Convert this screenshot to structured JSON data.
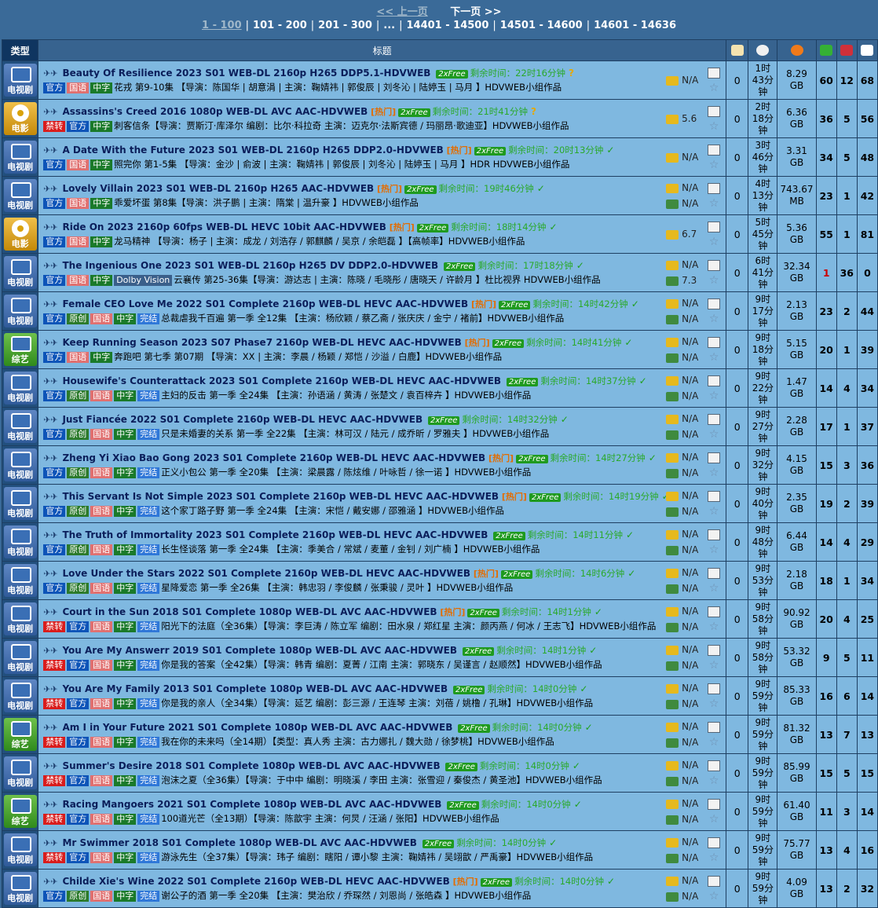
{
  "pager": {
    "prev": "<< 上一页",
    "next": "下一页 >>",
    "ranges": [
      "1 - 100",
      "101 - 200",
      "201 - 300",
      "...",
      "14401 - 14500",
      "14501 - 14600",
      "14601 - 14636"
    ]
  },
  "header": {
    "type": "类型",
    "title": "标题"
  },
  "rows": [
    {
      "cat": "电视剧",
      "kind": "tv",
      "title": "Beauty Of Resilience 2023 S01 WEB-DL 2160p H265 DDP5.1-HDVWEB",
      "hot": "",
      "free": "2xFree",
      "remain": "剩余时间：22时16分钟",
      "mark": "?",
      "tags": [
        "官方",
        "国语",
        "中字"
      ],
      "desc": "花戎 第9-10集 【导演：陈国华 | 胡意涓 | 主演：鞠婧祎 | 郭俊辰 | 刘冬沁 | 陆婷玉 | 马月 】HDVWEB小组作品",
      "r1": "N/A",
      "r2": "",
      "c": "0",
      "t": "1时\n43分钟",
      "s": "8.29\nGB",
      "se": "60",
      "le": "12",
      "sn": "68"
    },
    {
      "cat": "电影",
      "kind": "movie",
      "title": "Assassins's Creed 2016 1080p WEB-DL AVC AAC-HDVWEB",
      "hot": "[热门]",
      "free": "2xFree",
      "remain": "剩余时间：21时41分钟",
      "mark": "?",
      "tags": [
        "禁转",
        "官方",
        "中字"
      ],
      "desc": "刺客信条【导演：贾斯汀·库泽尔 编剧：比尔·科拉奇 主演：迈克尔·法斯宾德 / 玛丽昂·歌迪亚】HDVWEB小组作品",
      "r1": "5.6",
      "r2": "",
      "c": "0",
      "t": "2时\n18分钟",
      "s": "6.36\nGB",
      "se": "36",
      "le": "5",
      "sn": "56"
    },
    {
      "cat": "电视剧",
      "kind": "tv",
      "title": "A Date With the Future 2023 S01 WEB-DL 2160p H265 DDP2.0-HDVWEB",
      "hot": "[热门]",
      "free": "2xFree",
      "remain": "剩余时间：20时13分钟",
      "mark": "✓",
      "tags": [
        "官方",
        "国语",
        "中字"
      ],
      "desc": "照完你 第1-5集 【导演：金沙 | 俞波 | 主演：鞠婧祎 | 郭俊辰 | 刘冬沁 | 陆婷玉 | 马月 】HDR HDVWEB小组作品",
      "r1": "N/A",
      "r2": "",
      "c": "0",
      "t": "3时\n46分钟",
      "s": "3.31\nGB",
      "se": "34",
      "le": "5",
      "sn": "48"
    },
    {
      "cat": "电视剧",
      "kind": "tv",
      "title": "Lovely Villain 2023 S01 WEB-DL 2160p H265 AAC-HDVWEB",
      "hot": "[热门]",
      "free": "2xFree",
      "remain": "剩余时间：19时46分钟",
      "mark": "✓",
      "tags": [
        "官方",
        "国语",
        "中字"
      ],
      "desc": "乖爱坏蛋 第8集【导演：洪子鹏 | 主演：隋棠 | 温升豪 】HDVWEB小组作品",
      "r1": "N/A",
      "r2": "N/A",
      "c": "0",
      "t": "4时\n13分钟",
      "s": "743.67\nMB",
      "se": "23",
      "le": "1",
      "sn": "42"
    },
    {
      "cat": "电影",
      "kind": "movie",
      "title": "Ride On 2023 2160p 60fps WEB-DL HEVC 10bit AAC-HDVWEB",
      "hot": "[热门]",
      "free": "2xFree",
      "remain": "剩余时间：18时14分钟",
      "mark": "✓",
      "tags": [
        "官方",
        "国语",
        "中字"
      ],
      "desc": "龙马精神 【导演：杨子 | 主演：成龙 / 刘浩存 / 郭麒麟 / 吴京 / 余皑磊 】【高帧率】HDVWEB小组作品",
      "r1": "6.7",
      "r2": "",
      "c": "0",
      "t": "5时\n45分钟",
      "s": "5.36\nGB",
      "se": "55",
      "le": "1",
      "sn": "81"
    },
    {
      "cat": "电视剧",
      "kind": "tv",
      "title": "The Ingenious One 2023 S01 WEB-DL 2160p H265 DV DDP2.0-HDVWEB",
      "hot": "",
      "free": "2xFree",
      "remain": "剩余时间：17时18分钟",
      "mark": "✓",
      "tags": [
        "官方",
        "国语",
        "中字",
        "Dolby Vision"
      ],
      "desc": "云襄传 第25-36集【导演：游达志 | 主演：陈晓 / 毛晓彤 / 唐晓天 / 许龄月 】杜比视界 HDVWEB小组作品",
      "r1": "N/A",
      "r2": "7.3",
      "c": "0",
      "t": "6时\n41分钟",
      "s": "32.34\nGB",
      "se": "1",
      "le": "36",
      "sn": "0"
    },
    {
      "cat": "电视剧",
      "kind": "tv",
      "title": "Female CEO Love Me 2022 S01 Complete 2160p WEB-DL HEVC AAC-HDVWEB",
      "hot": "[热门]",
      "free": "2xFree",
      "remain": "剩余时间：14时42分钟",
      "mark": "✓",
      "tags": [
        "官方",
        "原创",
        "国语",
        "中字",
        "完结"
      ],
      "desc": "总裁虐我千百遍 第一季 全12集 【主演：杨欣颖 / 蔡乙斋 / 张庆庆 / 金宁 / 褚前】HDVWEB小组作品",
      "r1": "N/A",
      "r2": "N/A",
      "c": "0",
      "t": "9时\n17分钟",
      "s": "2.13\nGB",
      "se": "23",
      "le": "2",
      "sn": "44"
    },
    {
      "cat": "综艺",
      "kind": "var",
      "title": "Keep Running Season 2023 S07 Phase7 2160p WEB-DL HEVC AAC-HDVWEB",
      "hot": "[热门]",
      "free": "2xFree",
      "remain": "剩余时间：14时41分钟",
      "mark": "✓",
      "tags": [
        "官方",
        "国语",
        "中字"
      ],
      "desc": "奔跑吧 第七季 第07期 【导演：XX | 主演：李晨 / 杨颖 / 郑恺 / 沙溢 / 白鹿】HDVWEB小组作品",
      "r1": "N/A",
      "r2": "N/A",
      "c": "0",
      "t": "9时\n18分钟",
      "s": "5.15\nGB",
      "se": "20",
      "le": "1",
      "sn": "39"
    },
    {
      "cat": "电视剧",
      "kind": "tv",
      "title": "Housewife's Counterattack 2023 S01 Complete 2160p WEB-DL HEVC AAC-HDVWEB",
      "hot": "",
      "free": "2xFree",
      "remain": "剩余时间：14时37分钟",
      "mark": "✓",
      "tags": [
        "官方",
        "原创",
        "国语",
        "中字",
        "完结"
      ],
      "desc": "主妇的反击 第一季 全24集 【主演：孙语涵 / 黄涛 / 张楚文 / 袁百梓卉 】HDVWEB小组作品",
      "r1": "N/A",
      "r2": "N/A",
      "c": "0",
      "t": "9时\n22分钟",
      "s": "1.47\nGB",
      "se": "14",
      "le": "4",
      "sn": "34"
    },
    {
      "cat": "电视剧",
      "kind": "tv",
      "title": "Just Fiancée 2022 S01 Complete 2160p WEB-DL HEVC AAC-HDVWEB",
      "hot": "",
      "free": "2xFree",
      "remain": "剩余时间：14时32分钟",
      "mark": "✓",
      "tags": [
        "官方",
        "原创",
        "国语",
        "中字",
        "完结"
      ],
      "desc": "只是未婚妻的关系 第一季 全22集 【主演：林可汉 / 陆元 / 成乔昕 / 罗雅夫 】HDVWEB小组作品",
      "r1": "N/A",
      "r2": "N/A",
      "c": "0",
      "t": "9时\n27分钟",
      "s": "2.28\nGB",
      "se": "17",
      "le": "1",
      "sn": "37"
    },
    {
      "cat": "电视剧",
      "kind": "tv",
      "title": "Zheng Yi Xiao Bao Gong 2023 S01 Complete 2160p WEB-DL HEVC AAC-HDVWEB",
      "hot": "[热门]",
      "free": "2xFree",
      "remain": "剩余时间：14时27分钟",
      "mark": "✓",
      "tags": [
        "官方",
        "原创",
        "国语",
        "中字",
        "完结"
      ],
      "desc": "正义小包公 第一季 全20集 【主演：梁晨露 / 陈炫维 / 叶咏哲 / 徐一诺 】HDVWEB小组作品",
      "r1": "N/A",
      "r2": "N/A",
      "c": "0",
      "t": "9时\n32分钟",
      "s": "4.15\nGB",
      "se": "15",
      "le": "3",
      "sn": "36"
    },
    {
      "cat": "电视剧",
      "kind": "tv",
      "title": "This Servant Is Not Simple 2023 S01 Complete 2160p WEB-DL HEVC AAC-HDVWEB",
      "hot": "[热门]",
      "free": "2xFree",
      "remain": "剩余时间：14时19分钟",
      "mark": "✓",
      "tags": [
        "官方",
        "原创",
        "国语",
        "中字",
        "完结"
      ],
      "desc": "这个家丁路子野 第一季 全24集 【主演：宋恺 / 戴安娜 / 邵雅涵 】HDVWEB小组作品",
      "r1": "N/A",
      "r2": "N/A",
      "c": "0",
      "t": "9时\n40分钟",
      "s": "2.35\nGB",
      "se": "19",
      "le": "2",
      "sn": "39"
    },
    {
      "cat": "电视剧",
      "kind": "tv",
      "title": "The Truth of Immortality 2023 S01 Complete 2160p WEB-DL HEVC AAC-HDVWEB",
      "hot": "",
      "free": "2xFree",
      "remain": "剩余时间：14时11分钟",
      "mark": "✓",
      "tags": [
        "官方",
        "原创",
        "国语",
        "中字",
        "完结"
      ],
      "desc": "长生怪谈落 第一季 全24集 【主演：季美合 / 常斌 / 麦董 / 金钊 / 刘广楠 】HDVWEB小组作品",
      "r1": "N/A",
      "r2": "N/A",
      "c": "0",
      "t": "9时\n48分钟",
      "s": "6.44\nGB",
      "se": "14",
      "le": "4",
      "sn": "29"
    },
    {
      "cat": "电视剧",
      "kind": "tv",
      "title": "Love Under the Stars 2022 S01 Complete 2160p WEB-DL HEVC AAC-HDVWEB",
      "hot": "[热门]",
      "free": "2xFree",
      "remain": "剩余时间：14时6分钟",
      "mark": "✓",
      "tags": [
        "官方",
        "原创",
        "国语",
        "中字",
        "完结"
      ],
      "desc": "星降爱恋 第一季 全26集 【主演：韩忠羽 / 李俊麟 / 张秉骏 / 灵叶 】HDVWEB小组作品",
      "r1": "N/A",
      "r2": "N/A",
      "c": "0",
      "t": "9时\n53分钟",
      "s": "2.18\nGB",
      "se": "18",
      "le": "1",
      "sn": "34"
    },
    {
      "cat": "电视剧",
      "kind": "tv",
      "title": "Court in the Sun 2018 S01 Complete 1080p WEB-DL AVC AAC-HDVWEB",
      "hot": "[热门]",
      "free": "2xFree",
      "remain": "剩余时间：14时1分钟",
      "mark": "✓",
      "tags": [
        "禁转",
        "官方",
        "国语",
        "中字",
        "完结"
      ],
      "desc": "阳光下的法庭（全36集）【导演：李巨涛 / 陈立军 编剧：田水泉 / 郑红星 主演：颜丙燕 / 何冰 / 王志飞】HDVWEB小组作品",
      "r1": "N/A",
      "r2": "N/A",
      "c": "0",
      "t": "9时\n58分钟",
      "s": "90.92\nGB",
      "se": "20",
      "le": "4",
      "sn": "25"
    },
    {
      "cat": "电视剧",
      "kind": "tv",
      "title": "You Are My Answerr 2019 S01 Complete 1080p WEB-DL AVC AAC-HDVWEB",
      "hot": "",
      "free": "2xFree",
      "remain": "剩余时间：14时1分钟",
      "mark": "✓",
      "tags": [
        "禁转",
        "官方",
        "国语",
        "中字",
        "完结"
      ],
      "desc": "你是我的答案（全42集）【导演：韩青 编剧：夏菁 / 江南 主演：郭晓东 / 吴谨言 / 赵顺然】HDVWEB小组作品",
      "r1": "N/A",
      "r2": "N/A",
      "c": "0",
      "t": "9时\n58分钟",
      "s": "53.32\nGB",
      "se": "9",
      "le": "5",
      "sn": "11"
    },
    {
      "cat": "电视剧",
      "kind": "tv",
      "title": "You Are My Family 2013 S01 Complete 1080p WEB-DL AVC AAC-HDVWEB",
      "hot": "",
      "free": "2xFree",
      "remain": "剩余时间：14时0分钟",
      "mark": "✓",
      "tags": [
        "禁转",
        "官方",
        "国语",
        "中字",
        "完结"
      ],
      "desc": "你是我的亲人（全34集）【导演：延艺 编剧：彭三源 / 王连琴 主演：刘蓓 / 姚橹 / 孔琳】HDVWEB小组作品",
      "r1": "N/A",
      "r2": "N/A",
      "c": "0",
      "t": "9时\n59分钟",
      "s": "85.33\nGB",
      "se": "16",
      "le": "6",
      "sn": "14"
    },
    {
      "cat": "综艺",
      "kind": "var",
      "title": "Am I in Your Future 2021 S01 Complete 1080p WEB-DL AVC AAC-HDVWEB",
      "hot": "",
      "free": "2xFree",
      "remain": "剩余时间：14时0分钟",
      "mark": "✓",
      "tags": [
        "禁转",
        "官方",
        "国语",
        "中字",
        "完结"
      ],
      "desc": "我在你的未来吗（全14期）【类型：真人秀 主演：古力娜扎 / 魏大勋 / 徐梦桃】HDVWEB小组作品",
      "r1": "N/A",
      "r2": "N/A",
      "c": "0",
      "t": "9时\n59分钟",
      "s": "81.32\nGB",
      "se": "13",
      "le": "7",
      "sn": "13"
    },
    {
      "cat": "电视剧",
      "kind": "tv",
      "title": "Summer's Desire 2018 S01 Complete 1080p WEB-DL AVC AAC-HDVWEB",
      "hot": "",
      "free": "2xFree",
      "remain": "剩余时间：14时0分钟",
      "mark": "✓",
      "tags": [
        "禁转",
        "官方",
        "国语",
        "中字",
        "完结"
      ],
      "desc": "泡沫之夏（全36集）【导演：于中中 编剧：明晓溪 / 李田 主演：张雪迎 / 秦俊杰 / 黄圣池】HDVWEB小组作品",
      "r1": "N/A",
      "r2": "N/A",
      "c": "0",
      "t": "9时\n59分钟",
      "s": "85.99\nGB",
      "se": "15",
      "le": "5",
      "sn": "15"
    },
    {
      "cat": "综艺",
      "kind": "var",
      "title": "Racing Mangoers 2021 S01 Complete 1080p WEB-DL AVC AAC-HDVWEB",
      "hot": "",
      "free": "2xFree",
      "remain": "剩余时间：14时0分钟",
      "mark": "✓",
      "tags": [
        "禁转",
        "官方",
        "国语",
        "中字",
        "完结"
      ],
      "desc": "100道光芒（全13期）【导演：陈歆宇 主演：何炅 / 汪涵 / 张阳】HDVWEB小组作品",
      "r1": "N/A",
      "r2": "N/A",
      "c": "0",
      "t": "9时\n59分钟",
      "s": "61.40\nGB",
      "se": "11",
      "le": "3",
      "sn": "14"
    },
    {
      "cat": "电视剧",
      "kind": "tv",
      "title": "Mr Swimmer 2018 S01 Complete 1080p WEB-DL AVC AAC-HDVWEB",
      "hot": "",
      "free": "2xFree",
      "remain": "剩余时间：14时0分钟",
      "mark": "✓",
      "tags": [
        "禁转",
        "官方",
        "国语",
        "中字",
        "完结"
      ],
      "desc": "游泳先生（全37集）【导演：玮子 编剧：瞎阳 / 谭小黎 主演：鞠婧祎 / 吴翊歆 / 严禹豪】HDVWEB小组作品",
      "r1": "N/A",
      "r2": "N/A",
      "c": "0",
      "t": "9时\n59分钟",
      "s": "75.77\nGB",
      "se": "13",
      "le": "4",
      "sn": "16"
    },
    {
      "cat": "电视剧",
      "kind": "tv",
      "title": "Childe Xie's Wine 2022 S01 Complete 2160p WEB-DL HEVC AAC-HDVWEB",
      "hot": "[热门]",
      "free": "2xFree",
      "remain": "剩余时间：14时0分钟",
      "mark": "✓",
      "tags": [
        "官方",
        "原创",
        "国语",
        "中字",
        "完结"
      ],
      "desc": "谢公子的酒 第一季 全20集 【主演：樊治欣 / 乔琛然 / 刘恩尚 / 张皓森 】HDVWEB小组作品",
      "r1": "N/A",
      "r2": "N/A",
      "c": "0",
      "t": "9时\n59分钟",
      "s": "4.09\nGB",
      "se": "13",
      "le": "2",
      "sn": "32"
    }
  ]
}
